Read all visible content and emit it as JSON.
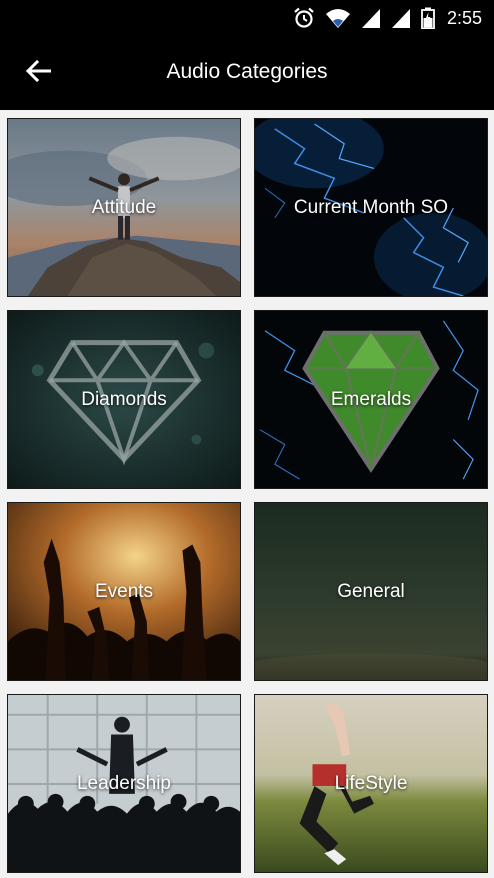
{
  "status_bar": {
    "time": "2:55",
    "icons": [
      "alarm-icon",
      "wifi-icon",
      "signal-icon",
      "signal-icon",
      "battery-icon"
    ]
  },
  "app_bar": {
    "back_icon": "arrow-left-icon",
    "title": "Audio Categories"
  },
  "categories": [
    {
      "label": "Attitude"
    },
    {
      "label": "Current Month SO"
    },
    {
      "label": "Diamonds"
    },
    {
      "label": "Emeralds"
    },
    {
      "label": "Events"
    },
    {
      "label": "General"
    },
    {
      "label": "Leadership"
    },
    {
      "label": "LifeStyle"
    }
  ]
}
